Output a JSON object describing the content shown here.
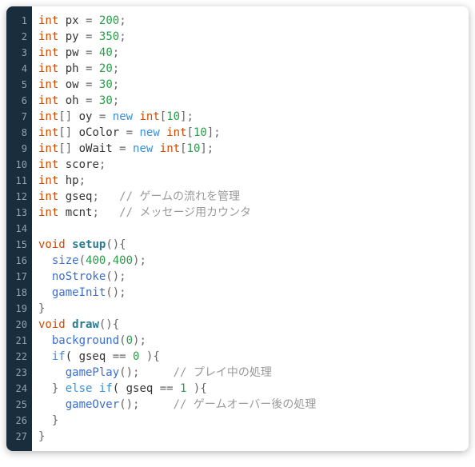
{
  "code": {
    "lines": [
      [
        {
          "t": "int",
          "c": "tok-type"
        },
        {
          "t": " px ",
          "c": "tok-ident"
        },
        {
          "t": "=",
          "c": "tok-punct"
        },
        {
          "t": " ",
          "c": ""
        },
        {
          "t": "200",
          "c": "tok-num"
        },
        {
          "t": ";",
          "c": "tok-punct"
        }
      ],
      [
        {
          "t": "int",
          "c": "tok-type"
        },
        {
          "t": " py ",
          "c": "tok-ident"
        },
        {
          "t": "=",
          "c": "tok-punct"
        },
        {
          "t": " ",
          "c": ""
        },
        {
          "t": "350",
          "c": "tok-num"
        },
        {
          "t": ";",
          "c": "tok-punct"
        }
      ],
      [
        {
          "t": "int",
          "c": "tok-type"
        },
        {
          "t": " pw ",
          "c": "tok-ident"
        },
        {
          "t": "=",
          "c": "tok-punct"
        },
        {
          "t": " ",
          "c": ""
        },
        {
          "t": "40",
          "c": "tok-num"
        },
        {
          "t": ";",
          "c": "tok-punct"
        }
      ],
      [
        {
          "t": "int",
          "c": "tok-type"
        },
        {
          "t": " ph ",
          "c": "tok-ident"
        },
        {
          "t": "=",
          "c": "tok-punct"
        },
        {
          "t": " ",
          "c": ""
        },
        {
          "t": "20",
          "c": "tok-num"
        },
        {
          "t": ";",
          "c": "tok-punct"
        }
      ],
      [
        {
          "t": "int",
          "c": "tok-type"
        },
        {
          "t": " ow ",
          "c": "tok-ident"
        },
        {
          "t": "=",
          "c": "tok-punct"
        },
        {
          "t": " ",
          "c": ""
        },
        {
          "t": "30",
          "c": "tok-num"
        },
        {
          "t": ";",
          "c": "tok-punct"
        }
      ],
      [
        {
          "t": "int",
          "c": "tok-type"
        },
        {
          "t": " oh ",
          "c": "tok-ident"
        },
        {
          "t": "=",
          "c": "tok-punct"
        },
        {
          "t": " ",
          "c": ""
        },
        {
          "t": "30",
          "c": "tok-num"
        },
        {
          "t": ";",
          "c": "tok-punct"
        }
      ],
      [
        {
          "t": "int",
          "c": "tok-type"
        },
        {
          "t": "[] ",
          "c": "tok-punct"
        },
        {
          "t": "oy ",
          "c": "tok-ident"
        },
        {
          "t": "=",
          "c": "tok-punct"
        },
        {
          "t": " ",
          "c": ""
        },
        {
          "t": "new",
          "c": "tok-kw"
        },
        {
          "t": " ",
          "c": ""
        },
        {
          "t": "int",
          "c": "tok-type"
        },
        {
          "t": "[",
          "c": "tok-punct"
        },
        {
          "t": "10",
          "c": "tok-num"
        },
        {
          "t": "];",
          "c": "tok-punct"
        }
      ],
      [
        {
          "t": "int",
          "c": "tok-type"
        },
        {
          "t": "[] ",
          "c": "tok-punct"
        },
        {
          "t": "oColor ",
          "c": "tok-ident"
        },
        {
          "t": "=",
          "c": "tok-punct"
        },
        {
          "t": " ",
          "c": ""
        },
        {
          "t": "new",
          "c": "tok-kw"
        },
        {
          "t": " ",
          "c": ""
        },
        {
          "t": "int",
          "c": "tok-type"
        },
        {
          "t": "[",
          "c": "tok-punct"
        },
        {
          "t": "10",
          "c": "tok-num"
        },
        {
          "t": "];",
          "c": "tok-punct"
        }
      ],
      [
        {
          "t": "int",
          "c": "tok-type"
        },
        {
          "t": "[] ",
          "c": "tok-punct"
        },
        {
          "t": "oWait ",
          "c": "tok-ident"
        },
        {
          "t": "=",
          "c": "tok-punct"
        },
        {
          "t": " ",
          "c": ""
        },
        {
          "t": "new",
          "c": "tok-kw"
        },
        {
          "t": " ",
          "c": ""
        },
        {
          "t": "int",
          "c": "tok-type"
        },
        {
          "t": "[",
          "c": "tok-punct"
        },
        {
          "t": "10",
          "c": "tok-num"
        },
        {
          "t": "];",
          "c": "tok-punct"
        }
      ],
      [
        {
          "t": "int",
          "c": "tok-type"
        },
        {
          "t": " score",
          "c": "tok-ident"
        },
        {
          "t": ";",
          "c": "tok-punct"
        }
      ],
      [
        {
          "t": "int",
          "c": "tok-type"
        },
        {
          "t": " hp",
          "c": "tok-ident"
        },
        {
          "t": ";",
          "c": "tok-punct"
        }
      ],
      [
        {
          "t": "int",
          "c": "tok-type"
        },
        {
          "t": " gseq",
          "c": "tok-ident"
        },
        {
          "t": ";   ",
          "c": "tok-punct"
        },
        {
          "t": "// ゲームの流れを管理",
          "c": "tok-comment"
        }
      ],
      [
        {
          "t": "int",
          "c": "tok-type"
        },
        {
          "t": " mcnt",
          "c": "tok-ident"
        },
        {
          "t": ";   ",
          "c": "tok-punct"
        },
        {
          "t": "// メッセージ用カウンタ",
          "c": "tok-comment"
        }
      ],
      [
        {
          "t": "",
          "c": ""
        }
      ],
      [
        {
          "t": "void",
          "c": "tok-type"
        },
        {
          "t": " ",
          "c": ""
        },
        {
          "t": "setup",
          "c": "tok-funcdef"
        },
        {
          "t": "(){",
          "c": "tok-punct"
        }
      ],
      [
        {
          "t": "  ",
          "c": ""
        },
        {
          "t": "size",
          "c": "tok-call"
        },
        {
          "t": "(",
          "c": "tok-punct"
        },
        {
          "t": "400",
          "c": "tok-num"
        },
        {
          "t": ",",
          "c": "tok-punct"
        },
        {
          "t": "400",
          "c": "tok-num"
        },
        {
          "t": ");",
          "c": "tok-punct"
        }
      ],
      [
        {
          "t": "  ",
          "c": ""
        },
        {
          "t": "noStroke",
          "c": "tok-call"
        },
        {
          "t": "();",
          "c": "tok-punct"
        }
      ],
      [
        {
          "t": "  ",
          "c": ""
        },
        {
          "t": "gameInit",
          "c": "tok-call"
        },
        {
          "t": "();",
          "c": "tok-punct"
        }
      ],
      [
        {
          "t": "}",
          "c": "tok-punct"
        }
      ],
      [
        {
          "t": "void",
          "c": "tok-type"
        },
        {
          "t": " ",
          "c": ""
        },
        {
          "t": "draw",
          "c": "tok-funcdef"
        },
        {
          "t": "(){",
          "c": "tok-punct"
        }
      ],
      [
        {
          "t": "  ",
          "c": ""
        },
        {
          "t": "background",
          "c": "tok-call"
        },
        {
          "t": "(",
          "c": "tok-punct"
        },
        {
          "t": "0",
          "c": "tok-num"
        },
        {
          "t": ");",
          "c": "tok-punct"
        }
      ],
      [
        {
          "t": "  ",
          "c": ""
        },
        {
          "t": "if",
          "c": "tok-kw"
        },
        {
          "t": "( gseq ",
          "c": "tok-ident"
        },
        {
          "t": "==",
          "c": "tok-punct"
        },
        {
          "t": " ",
          "c": ""
        },
        {
          "t": "0",
          "c": "tok-num"
        },
        {
          "t": " ){",
          "c": "tok-punct"
        }
      ],
      [
        {
          "t": "    ",
          "c": ""
        },
        {
          "t": "gamePlay",
          "c": "tok-call"
        },
        {
          "t": "();     ",
          "c": "tok-punct"
        },
        {
          "t": "// プレイ中の処理",
          "c": "tok-comment"
        }
      ],
      [
        {
          "t": "  } ",
          "c": "tok-punct"
        },
        {
          "t": "else",
          "c": "tok-kw"
        },
        {
          "t": " ",
          "c": ""
        },
        {
          "t": "if",
          "c": "tok-kw"
        },
        {
          "t": "( gseq ",
          "c": "tok-ident"
        },
        {
          "t": "==",
          "c": "tok-punct"
        },
        {
          "t": " ",
          "c": ""
        },
        {
          "t": "1",
          "c": "tok-num"
        },
        {
          "t": " ){",
          "c": "tok-punct"
        }
      ],
      [
        {
          "t": "    ",
          "c": ""
        },
        {
          "t": "gameOver",
          "c": "tok-call"
        },
        {
          "t": "();     ",
          "c": "tok-punct"
        },
        {
          "t": "// ゲームオーバー後の処理",
          "c": "tok-comment"
        }
      ],
      [
        {
          "t": "  }",
          "c": "tok-punct"
        }
      ],
      [
        {
          "t": "}",
          "c": "tok-punct"
        }
      ]
    ]
  }
}
